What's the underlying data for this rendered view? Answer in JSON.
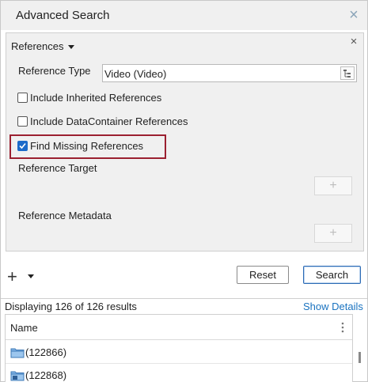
{
  "window": {
    "title": "Advanced Search"
  },
  "panel": {
    "header": "References",
    "reference_type": {
      "label": "Reference Type",
      "value": "Video (Video)"
    },
    "options": [
      {
        "label": "Include Inherited References",
        "checked": false
      },
      {
        "label": "Include DataContainer References",
        "checked": false
      },
      {
        "label": "Find Missing References",
        "checked": true
      }
    ],
    "reference_target_label": "Reference Target",
    "reference_metadata_label": "Reference Metadata",
    "add_symbol": "+"
  },
  "actions": {
    "add_symbol": "+",
    "reset": "Reset",
    "search": "Search"
  },
  "results": {
    "summary": "Displaying 126 of 126 results",
    "show_details": "Show Details",
    "column_name": "Name",
    "rows": [
      {
        "name": "(122866)",
        "icon": "folder-icon"
      },
      {
        "name": "(122868)",
        "icon": "video-folder-icon"
      }
    ]
  },
  "colors": {
    "accent": "#1b6ac9",
    "highlight": "#9b2030",
    "link": "#1a73c0"
  }
}
